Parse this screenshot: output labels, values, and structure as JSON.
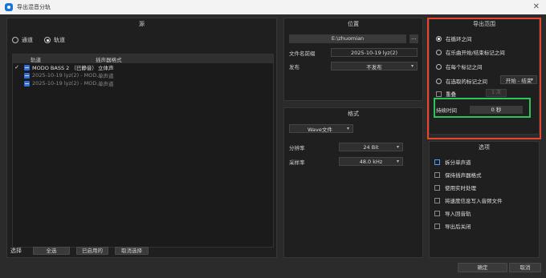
{
  "window": {
    "title": "导出混音分轨"
  },
  "source": {
    "title": "源",
    "radio_channel": "通道",
    "radio_track": "轨道",
    "columns": {
      "track": "轨道",
      "format": "插声器格式"
    },
    "tracks": [
      {
        "checked": true,
        "name": "MODO BASS 2 （已静音）",
        "format": "立体声"
      },
      {
        "checked": false,
        "name": "2025-10-19 lyz(2) - MOD...",
        "format": "单声道"
      },
      {
        "checked": false,
        "name": "2025-10-19 lyz(2) - MOD...",
        "format": "单声道"
      }
    ],
    "select_label": "选择",
    "btn_all": "全选",
    "btn_enabled": "已启用的",
    "btn_deselect": "取消选择"
  },
  "location": {
    "title": "位置",
    "path": "E:\\zhuomian",
    "browse": "...",
    "prefix_label": "文件名前缀",
    "prefix_value": "2025-10-19 lyz(2)",
    "publish_label": "发布",
    "publish_value": "不发布"
  },
  "format": {
    "title": "格式",
    "file_type": "Wave文件",
    "resolution_label": "分辨率",
    "resolution_value": "24 Bit",
    "samplerate_label": "采样率",
    "samplerate_value": "48.0 kHz"
  },
  "range": {
    "title": "导出范围",
    "items": [
      "在循环之间",
      "在乐曲开始/结束标记之间",
      "在每个标记之间",
      "在选取的标记之间"
    ],
    "marker_dropdown": "开始 - 结束",
    "repeat_label": "重叠",
    "repeat_value": "1 次",
    "duration_label": "持续时间",
    "duration_value": "0 秒"
  },
  "options": {
    "title": "选项",
    "items": [
      "拆分单声道",
      "保持插声器格式",
      "使用实时处理",
      "将速度信息写入音频文件",
      "导入回音轨",
      "导出后关闭"
    ]
  },
  "buttons": {
    "ok": "确定",
    "cancel": "取消"
  }
}
